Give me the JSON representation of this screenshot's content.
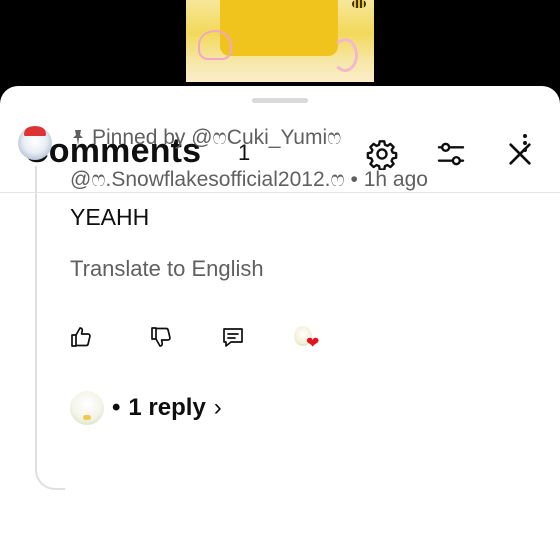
{
  "header": {
    "title": "Comments",
    "count": "1"
  },
  "comment": {
    "pinned_label": "Pinned by @ෆCuki_Yumiෆ",
    "author": "@ෆ.Snowflakesofficial2012.ෆ",
    "separator": "•",
    "time": "1h ago",
    "text": "YEAHH",
    "translate_label": "Translate to English"
  },
  "replies": {
    "bullet": "•",
    "label": "1 reply",
    "chevron": "›"
  },
  "icons": {
    "settings": "gear-icon",
    "filter": "sliders-icon",
    "close": "close-icon",
    "like": "thumbs-up-icon",
    "dislike": "thumbs-down-icon",
    "reply": "reply-icon",
    "more": "more-vertical-icon",
    "pin": "pin-icon",
    "creator_heart": "creator-heart-icon"
  },
  "colors": {
    "heart": "#e3141f",
    "secondary_text": "#606060"
  }
}
